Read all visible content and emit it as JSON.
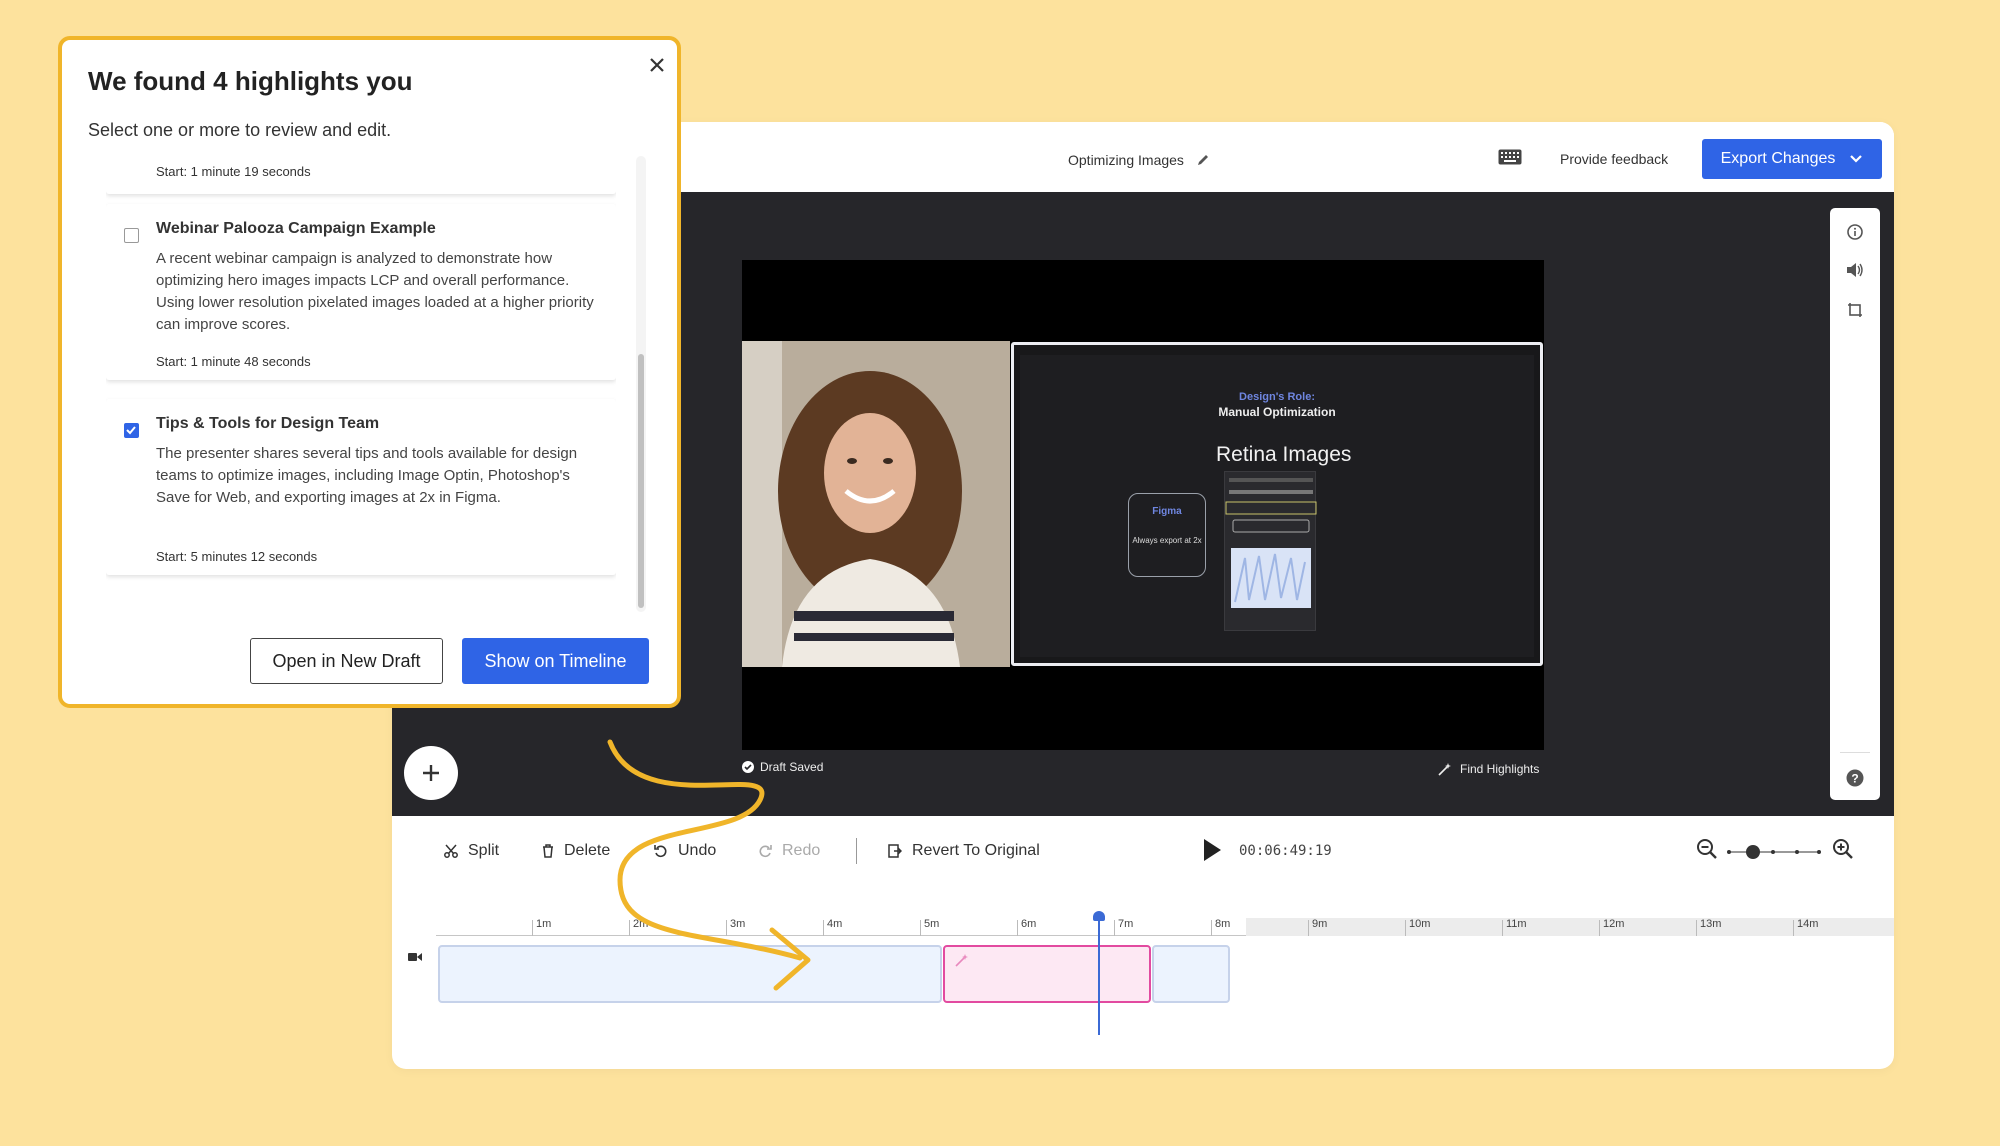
{
  "editor": {
    "doc_title": "Optimizing Images",
    "provide_feedback": "Provide feedback",
    "export_label": "Export Changes"
  },
  "preview": {
    "slide_subtitle": "Design's Role:",
    "slide_heading": "Manual Optimization",
    "slide_big": "Retina Images",
    "figma_title": "Figma",
    "figma_desc": "Always export at 2x",
    "draft_saved": "Draft Saved",
    "find_highlights": "Find Highlights"
  },
  "toolbar": {
    "split": "Split",
    "delete": "Delete",
    "undo": "Undo",
    "redo": "Redo",
    "revert": "Revert To Original",
    "timecode": "00:06:49:19"
  },
  "timeline": {
    "ticks": [
      "1m",
      "2m",
      "3m",
      "4m",
      "5m",
      "6m",
      "7m",
      "8m",
      "9m",
      "10m",
      "11m",
      "12m",
      "13m",
      "14m"
    ],
    "playhead_time": "6:49"
  },
  "popup": {
    "title": "We found 4 highlights you",
    "subtitle": "Select one or more to review and edit.",
    "cards": [
      {
        "title": "",
        "desc": "",
        "start": "Start:  1 minute 19 seconds",
        "checked": false
      },
      {
        "title": "Webinar Palooza Campaign Example",
        "desc": "A recent webinar campaign is analyzed to demonstrate how optimizing hero images impacts LCP and overall performance. Using lower resolution pixelated images loaded at a higher priority can improve scores.",
        "start": "Start:  1 minute 48 seconds",
        "checked": false
      },
      {
        "title": "Tips & Tools for Design Team",
        "desc": "The presenter shares several tips and tools available for design teams to optimize images, including Image Optin, Photoshop's Save for Web, and exporting images at 2x in Figma.",
        "start": "Start:  5 minutes 12 seconds",
        "checked": true
      }
    ],
    "open_label": "Open in New Draft",
    "show_label": "Show on Timeline"
  },
  "colors": {
    "background": "#fde29d",
    "accent": "#2f64e6",
    "popup_border": "#f0b52a",
    "highlight_clip": "#e24aa0"
  }
}
